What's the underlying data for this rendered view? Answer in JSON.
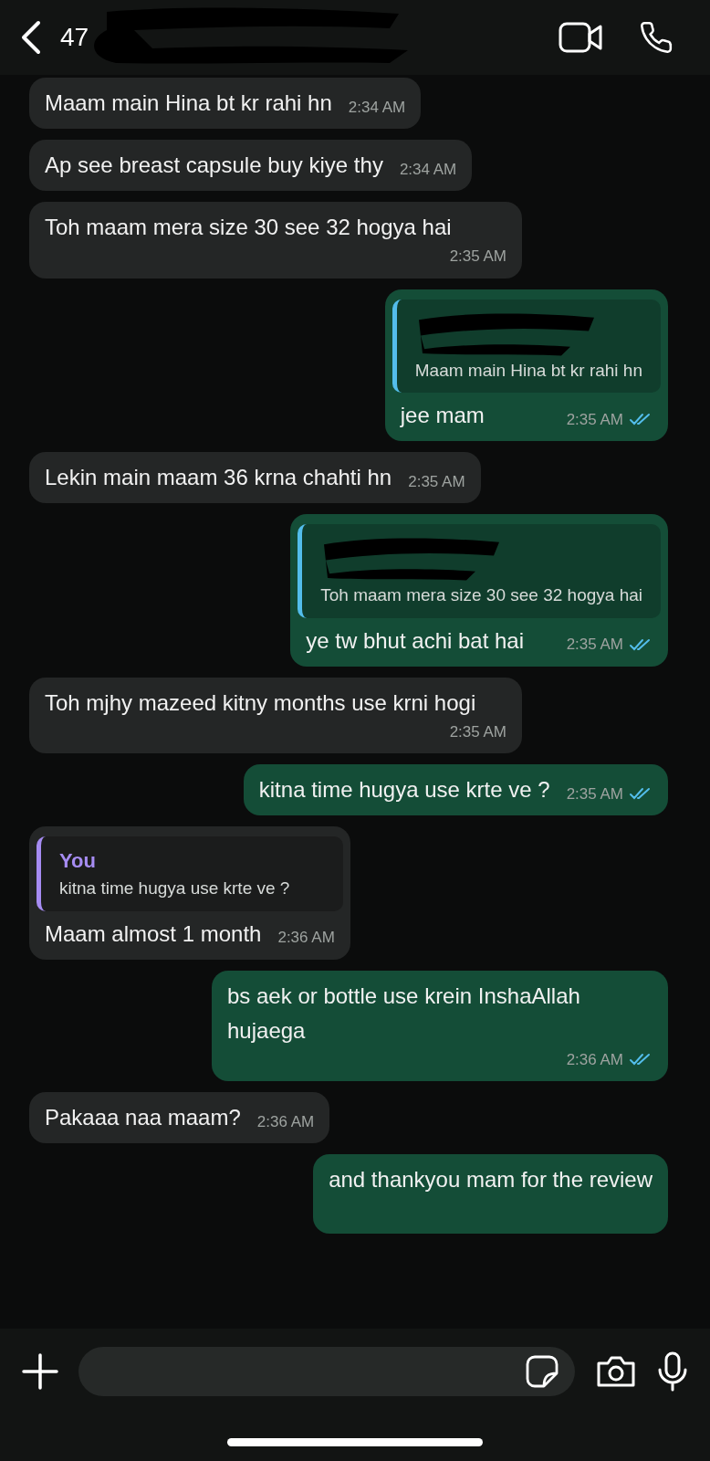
{
  "header": {
    "title": "47"
  },
  "messages": [
    {
      "kind": "in",
      "text": "Maam main Hina bt kr rahi hn",
      "time": "2:34 AM"
    },
    {
      "kind": "in",
      "text": "Ap see breast capsule buy kiye thy",
      "time": "2:34 AM"
    },
    {
      "kind": "in",
      "text": "Toh maam mera size 30 see 32 hogya hai",
      "time": "2:35 AM"
    },
    {
      "kind": "out",
      "quote": {
        "redacted": true,
        "text": "Maam main Hina bt kr rahi hn"
      },
      "text": "jee mam",
      "time": "2:35 AM",
      "read": true
    },
    {
      "kind": "in",
      "text": "Lekin main maam 36 krna chahti hn",
      "time": "2:35 AM"
    },
    {
      "kind": "out",
      "quote": {
        "redacted": true,
        "text": "Toh maam mera size 30 see 32 hogya hai"
      },
      "text": "ye tw bhut achi bat hai",
      "time": "2:35 AM",
      "read": true
    },
    {
      "kind": "in",
      "text": "Toh mjhy mazeed kitny months use krni hogi",
      "time": "2:35 AM"
    },
    {
      "kind": "out",
      "text": "kitna time hugya use krte ve ?",
      "time": "2:35 AM",
      "read": true
    },
    {
      "kind": "in",
      "quote": {
        "author": "You",
        "text": "kitna time hugya use krte ve ?"
      },
      "text": "Maam almost 1 month",
      "time": "2:36 AM"
    },
    {
      "kind": "out",
      "text": "bs aek or bottle use krein InshaAllah hujaega",
      "time": "2:36 AM",
      "read": true
    },
    {
      "kind": "in",
      "text": "Pakaaa naa maam?",
      "time": "2:36 AM"
    },
    {
      "kind": "out",
      "text": "and thankyou mam for the review"
    }
  ]
}
